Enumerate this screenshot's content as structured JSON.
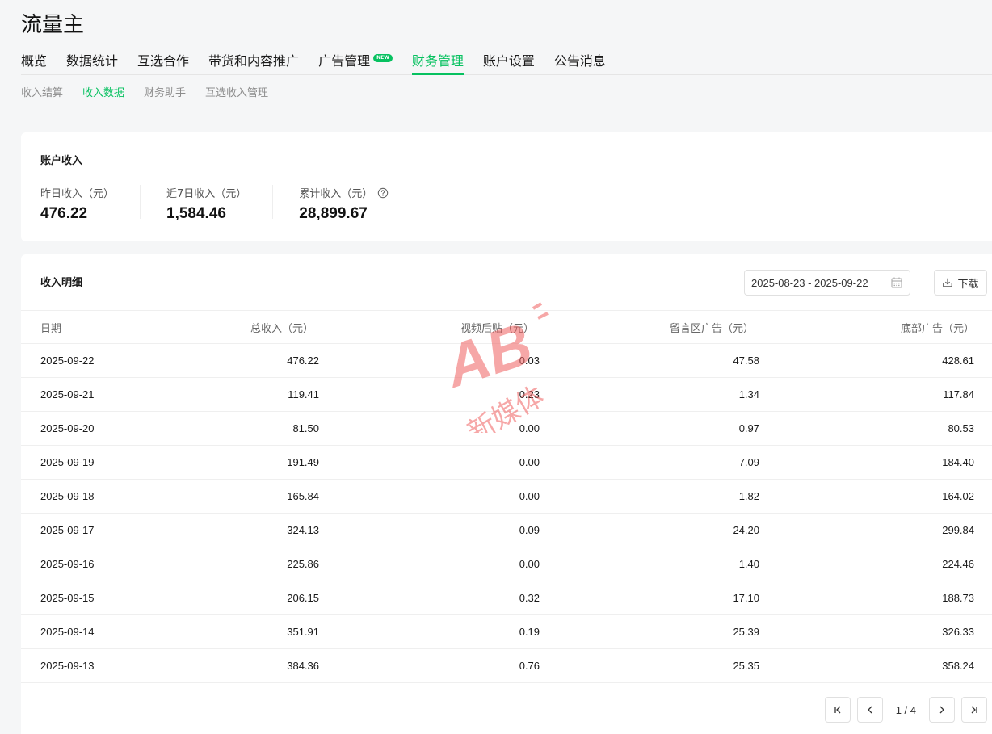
{
  "app": {
    "title": "流量主"
  },
  "main_nav": [
    {
      "label": "概览",
      "active": false
    },
    {
      "label": "数据统计",
      "active": false
    },
    {
      "label": "互选合作",
      "active": false
    },
    {
      "label": "带货和内容推广",
      "active": false
    },
    {
      "label": "广告管理",
      "active": false,
      "badge": "NEW"
    },
    {
      "label": "财务管理",
      "active": true
    },
    {
      "label": "账户设置",
      "active": false
    },
    {
      "label": "公告消息",
      "active": false
    }
  ],
  "sub_nav": [
    {
      "label": "收入结算",
      "active": false
    },
    {
      "label": "收入数据",
      "active": true
    },
    {
      "label": "财务助手",
      "active": false
    },
    {
      "label": "互选收入管理",
      "active": false
    }
  ],
  "income_card": {
    "title": "账户收入",
    "stats": [
      {
        "label": "昨日收入（元）",
        "value": "476.22"
      },
      {
        "label": "近7日收入（元）",
        "value": "1,584.46"
      },
      {
        "label": "累计收入（元）",
        "value": "28,899.67",
        "help_icon": "question-circle-icon"
      }
    ]
  },
  "detail_card": {
    "title": "收入明细",
    "date_range": "2025-08-23 - 2025-09-22",
    "download_label": "下载",
    "columns": [
      "日期",
      "总收入（元）",
      "视频后贴（元）",
      "留言区广告（元）",
      "底部广告（元）"
    ],
    "rows": [
      [
        "2025-09-22",
        "476.22",
        "0.03",
        "47.58",
        "428.61"
      ],
      [
        "2025-09-21",
        "119.41",
        "0.23",
        "1.34",
        "117.84"
      ],
      [
        "2025-09-20",
        "81.50",
        "0.00",
        "0.97",
        "80.53"
      ],
      [
        "2025-09-19",
        "191.49",
        "0.00",
        "7.09",
        "184.40"
      ],
      [
        "2025-09-18",
        "165.84",
        "0.00",
        "1.82",
        "164.02"
      ],
      [
        "2025-09-17",
        "324.13",
        "0.09",
        "24.20",
        "299.84"
      ],
      [
        "2025-09-16",
        "225.86",
        "0.00",
        "1.40",
        "224.46"
      ],
      [
        "2025-09-15",
        "206.15",
        "0.32",
        "17.10",
        "188.73"
      ],
      [
        "2025-09-14",
        "351.91",
        "0.19",
        "25.39",
        "326.33"
      ],
      [
        "2025-09-13",
        "384.36",
        "0.76",
        "25.35",
        "358.24"
      ]
    ],
    "pagination": {
      "text": "1 / 4"
    }
  },
  "watermark": {
    "line1": "AB",
    "line2": "新媒体"
  },
  "colors": {
    "accent": "#07c160",
    "watermark": "#f06060"
  }
}
